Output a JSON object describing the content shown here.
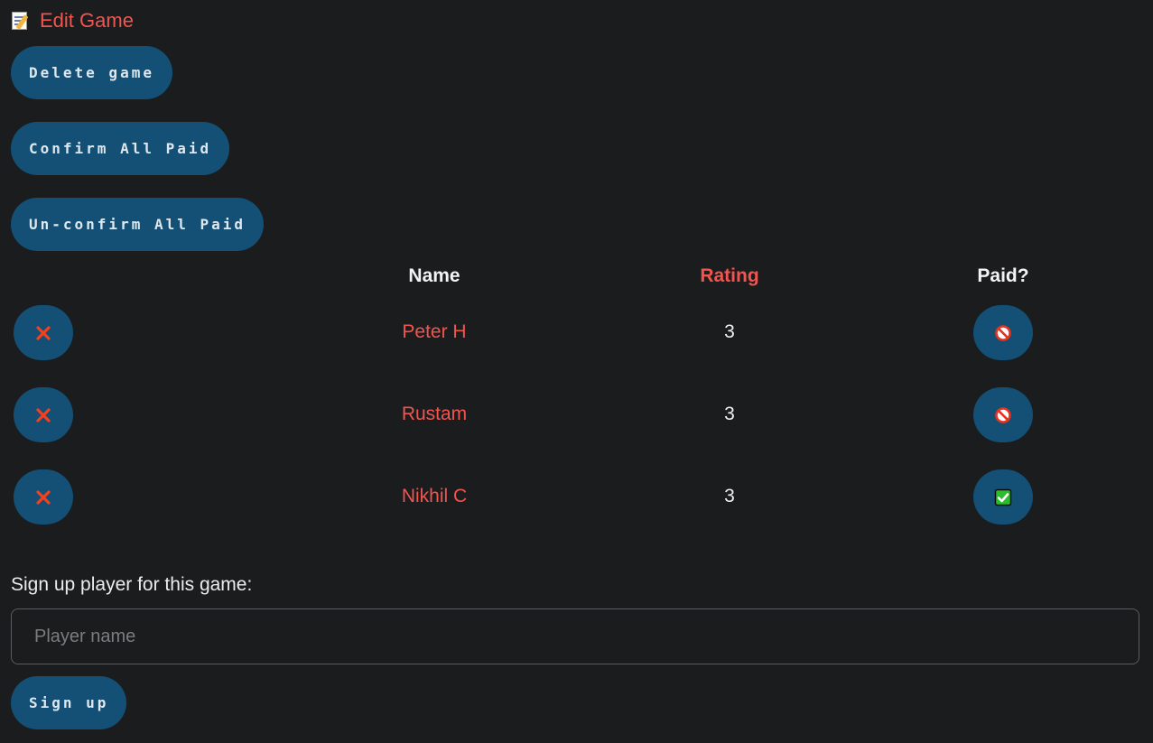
{
  "header": {
    "icon": "memo-icon",
    "title": "Edit Game"
  },
  "actions": {
    "delete_game": "Delete game",
    "confirm_all_paid": "Confirm All Paid",
    "unconfirm_all_paid": "Un-confirm All Paid"
  },
  "table": {
    "columns": {
      "name": "Name",
      "rating": "Rating",
      "paid": "Paid?"
    },
    "rows": [
      {
        "name": "Peter H",
        "rating": "3",
        "paid": false,
        "remove_icon": "cross-mark-icon",
        "paid_icon": "prohibited-icon"
      },
      {
        "name": "Rustam",
        "rating": "3",
        "paid": false,
        "remove_icon": "cross-mark-icon",
        "paid_icon": "prohibited-icon"
      },
      {
        "name": "Nikhil C",
        "rating": "3",
        "paid": true,
        "remove_icon": "cross-mark-icon",
        "paid_icon": "check-mark-icon"
      }
    ]
  },
  "signup": {
    "label": "Sign up player for this game:",
    "placeholder": "Player name",
    "value": "",
    "button": "Sign up"
  },
  "colors": {
    "background": "#1b1c1e",
    "button": "#145075",
    "accent": "#f2554f"
  }
}
